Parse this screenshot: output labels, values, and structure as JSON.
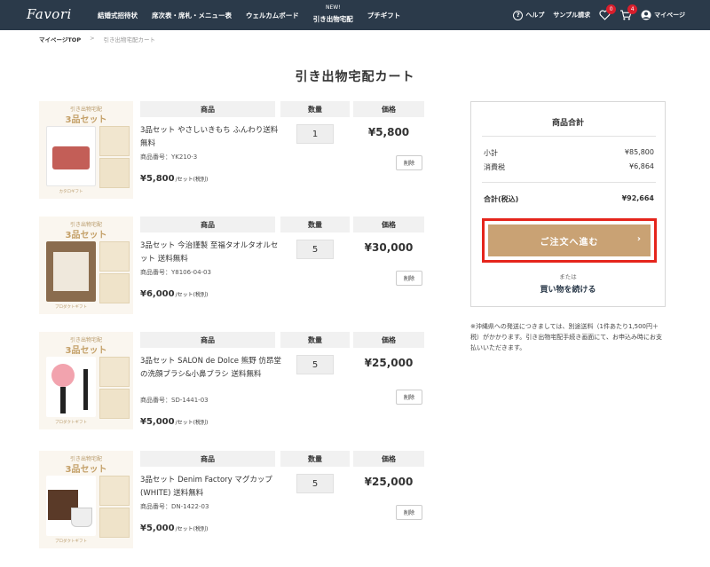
{
  "header": {
    "logo": "Favori",
    "nav": [
      {
        "label": "結婚式招待状",
        "new": ""
      },
      {
        "label": "席次表・席札・メニュー表",
        "new": ""
      },
      {
        "label": "ウェルカムボード",
        "new": ""
      },
      {
        "label": "引き出物宅配",
        "new": "NEW!"
      },
      {
        "label": "プチギフト",
        "new": ""
      }
    ],
    "help": "ヘルプ",
    "sample": "サンプル請求",
    "wishlist_count": "0",
    "cart_count": "4",
    "mypage": "マイページ"
  },
  "breadcrumb": {
    "home": "マイページTOP",
    "sep": ">",
    "current": "引き出物宅配カート"
  },
  "page_title": "引き出物宅配カート",
  "columns": {
    "name": "商品",
    "qty": "数量",
    "price": "価格"
  },
  "items": [
    {
      "thumb_top": "引き出物宅配",
      "thumb_title": "3品セット",
      "thumb_foot": "カタロギフト",
      "name": "3品セット やさしいきもち ふんわり送料無料",
      "code": "商品番号：YK210-3",
      "unit_price": "¥5,800",
      "unit_suffix": "/セット(税別)",
      "qty": "1",
      "price": "¥5,800",
      "delete": "削除"
    },
    {
      "thumb_top": "引き出物宅配",
      "thumb_title": "3品セット",
      "thumb_foot": "プロダクトギフト",
      "name": "3品セット 今治謹製 至福タオルタオルセット 送料無料",
      "code": "商品番号：Y8106-04-03",
      "unit_price": "¥6,000",
      "unit_suffix": "/セット(税別)",
      "qty": "5",
      "price": "¥30,000",
      "delete": "削除"
    },
    {
      "thumb_top": "引き出物宅配",
      "thumb_title": "3品セット",
      "thumb_foot": "プロダクトギフト",
      "name": "3品セット SALON de Dolce 熊野 仿昂堂の洗顔ブラシ&小鼻ブラシ 送料無料",
      "code": "商品番号：SD-1441-03",
      "unit_price": "¥5,000",
      "unit_suffix": "/セット(税別)",
      "qty": "5",
      "price": "¥25,000",
      "delete": "削除"
    },
    {
      "thumb_top": "引き出物宅配",
      "thumb_title": "3品セット",
      "thumb_foot": "プロダクトギフト",
      "name": "3品セット Denim Factory マグカップ(WHITE) 送料無料",
      "code": "商品番号：DN-1422-03",
      "unit_price": "¥5,000",
      "unit_suffix": "/セット(税別)",
      "qty": "5",
      "price": "¥25,000",
      "delete": "削除"
    }
  ],
  "summary": {
    "title": "商品合計",
    "subtotal_label": "小計",
    "subtotal": "¥85,800",
    "tax_label": "消費税",
    "tax": "¥6,864",
    "total_label": "合計(税込)",
    "total": "¥92,664",
    "checkout": "ご注文へ進む",
    "or": "または",
    "continue": "買い物を続ける"
  },
  "note": "※沖縄県への発送につきましては、別途送料（1件あたり1,500円＋税）がかかります。引き出物宅配手続き画面にて、お申込み時にお支払いいただきます。",
  "colors": {
    "header": "#2b3a4a",
    "accent": "#c9a274",
    "highlight": "#e5251c",
    "badge": "#d81e2c"
  }
}
